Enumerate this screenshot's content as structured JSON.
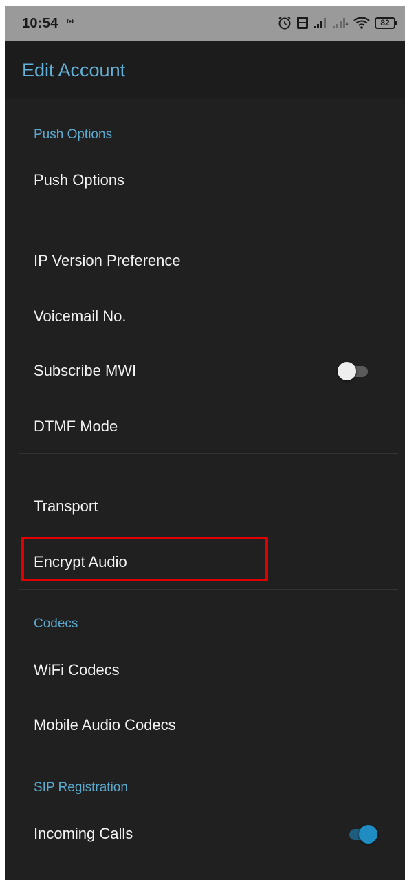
{
  "status_bar": {
    "time": "10:54",
    "battery": "82",
    "icons": [
      "hotspot-icon",
      "alarm-icon",
      "volte-icon",
      "signal-icon",
      "signal-no-service-icon",
      "wifi-icon",
      "battery-icon"
    ]
  },
  "app_bar": {
    "title": "Edit Account"
  },
  "sections": {
    "push_header": "Push Options",
    "codecs_header": "Codecs",
    "sip_header": "SIP Registration"
  },
  "items": {
    "push_options": "Push Options",
    "ip_version": "IP Version Preference",
    "voicemail": "Voicemail No.",
    "subscribe_mwi": "Subscribe MWI",
    "dtmf_mode": "DTMF Mode",
    "transport": "Transport",
    "encrypt_audio": "Encrypt Audio",
    "wifi_codecs": "WiFi Codecs",
    "mobile_codecs": "Mobile Audio Codecs",
    "incoming_calls": "Incoming Calls"
  },
  "toggles": {
    "subscribe_mwi": false,
    "incoming_calls": true
  },
  "colors": {
    "accent": "#5aa9cf",
    "highlight": "#e00000",
    "background": "#202020",
    "switch_on": "#1f8dc2"
  }
}
